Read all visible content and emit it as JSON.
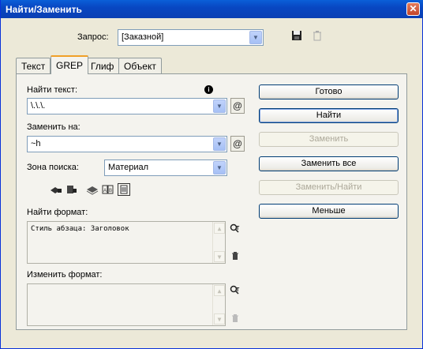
{
  "window": {
    "title": "Найти/Заменить"
  },
  "query": {
    "label": "Запрос:",
    "value": "[Заказной]"
  },
  "tabs": [
    {
      "label": "Текст"
    },
    {
      "label": "GREP"
    },
    {
      "label": "Глиф"
    },
    {
      "label": "Объект"
    }
  ],
  "find": {
    "label": "Найти текст:",
    "value": "\\.\\.\\."
  },
  "replace": {
    "label": "Заменить на:",
    "value": "~h"
  },
  "scope": {
    "label": "Зона поиска:",
    "value": "Материал"
  },
  "find_format": {
    "label": "Найти формат:",
    "value": "Стиль абзаца: Заголовок"
  },
  "change_format": {
    "label": "Изменить формат:",
    "value": ""
  },
  "buttons": {
    "done": "Готово",
    "find": "Найти",
    "replace": "Заменить",
    "replace_all": "Заменить все",
    "replace_find": "Заменить/Найти",
    "less": "Меньше"
  }
}
